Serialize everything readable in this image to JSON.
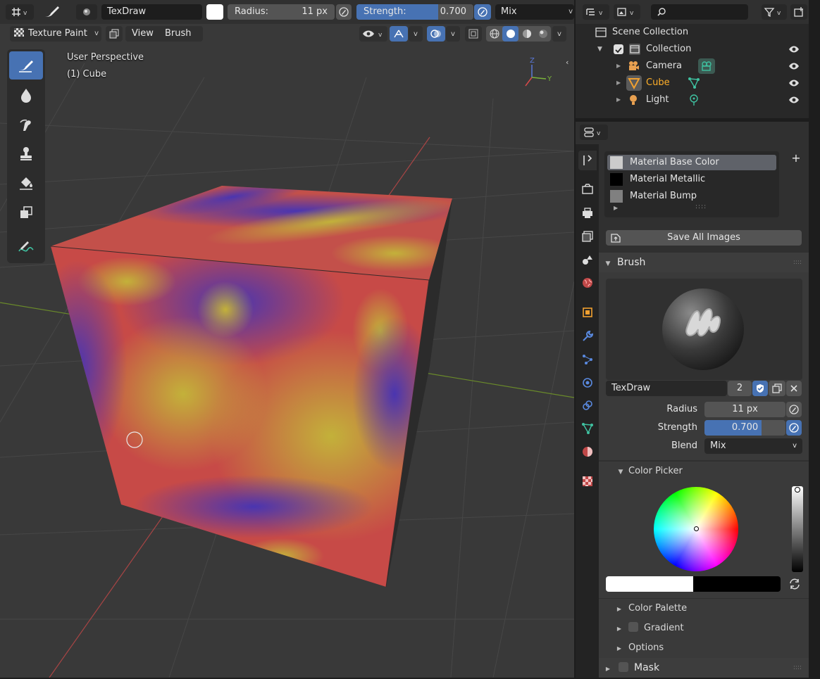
{
  "header": {
    "brush_name": "TexDraw",
    "radius_label": "Radius:",
    "radius_value": "11 px",
    "strength_label": "Strength:",
    "strength_value": "0.700",
    "strength_fraction": 0.7,
    "blend_mode": "Mix",
    "brush_color": "#ffffff"
  },
  "viewport_header": {
    "mode": "Texture Paint",
    "menus": [
      "View",
      "Brush"
    ]
  },
  "viewport": {
    "perspective": "User Perspective",
    "object": "(1) Cube",
    "gizmo": {
      "z": "Z",
      "y": "Y"
    }
  },
  "outliner": {
    "scene_collection": "Scene Collection",
    "collection": "Collection",
    "items": [
      {
        "name": "Camera",
        "color": "#e0e0e0"
      },
      {
        "name": "Cube",
        "color": "#ffaf29"
      },
      {
        "name": "Light",
        "color": "#e0e0e0"
      }
    ]
  },
  "properties": {
    "texture_slots": [
      {
        "name": "Material Base Color",
        "swatch": "#cccccc",
        "selected": true
      },
      {
        "name": "Material Metallic",
        "swatch": "#000000",
        "selected": false
      },
      {
        "name": "Material Bump",
        "swatch": "#808080",
        "selected": false
      }
    ],
    "save_all_images": "Save All Images",
    "brush_panel": {
      "title": "Brush",
      "brush_name": "TexDraw",
      "user_count": "2",
      "radius_label": "Radius",
      "radius_value": "11 px",
      "strength_label": "Strength",
      "strength_value": "0.700",
      "strength_fraction": 0.7,
      "blend_label": "Blend",
      "blend_value": "Mix"
    },
    "color_picker": "Color Picker",
    "color_palette": "Color Palette",
    "gradient": "Gradient",
    "options": "Options",
    "mask": "Mask"
  },
  "colors": {
    "accent": "#4772b3",
    "active_object": "#ffaf29",
    "object_data": "#3fc1a0"
  }
}
